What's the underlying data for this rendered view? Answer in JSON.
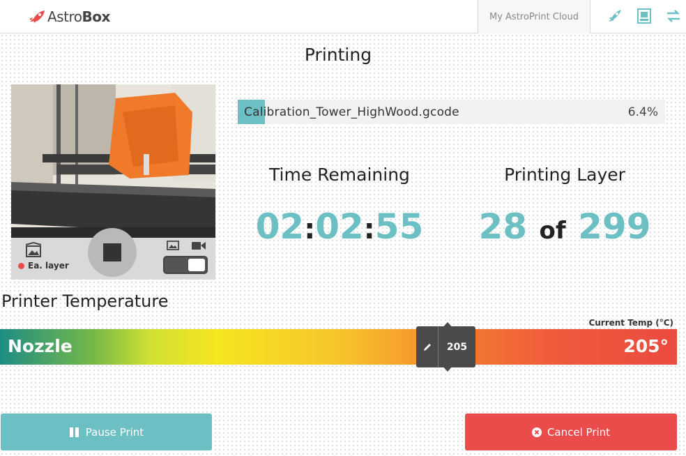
{
  "header": {
    "brand_prefix": "Astro",
    "brand_suffix": "Box",
    "cloud_label": "My AstroPrint Cloud",
    "icons": [
      "rocket-icon",
      "print-file-icon",
      "transfer-icon"
    ]
  },
  "title": "Printing",
  "camera": {
    "stop_icon": "stop-icon",
    "ea_layer_label": "Ea. layer",
    "photo_icon": "image-icon",
    "video_icon": "video-camera-icon",
    "gallery_icon": "gallery-icon"
  },
  "file": {
    "name": "Calibration_Tower_HighWood.gcode",
    "progress_percent_label": "6.4%",
    "progress": 0.064
  },
  "stats": {
    "time_label": "Time Remaining",
    "time_h": "02",
    "time_m": "02",
    "time_s": "55",
    "layer_label": "Printing Layer",
    "layer_current": "28",
    "layer_of": "of",
    "layer_total": "299"
  },
  "temperature": {
    "section_title": "Printer Temperature",
    "current_label": "Current Temp (°C)",
    "nozzle_label": "Nozzle",
    "target_value": "205",
    "current_value": "205°"
  },
  "actions": {
    "pause_label": "Pause Print",
    "cancel_label": "Cancel Print"
  },
  "colors": {
    "accent": "#6cc0c3",
    "danger": "#ea4b4b",
    "dark": "#4a4a4a"
  }
}
